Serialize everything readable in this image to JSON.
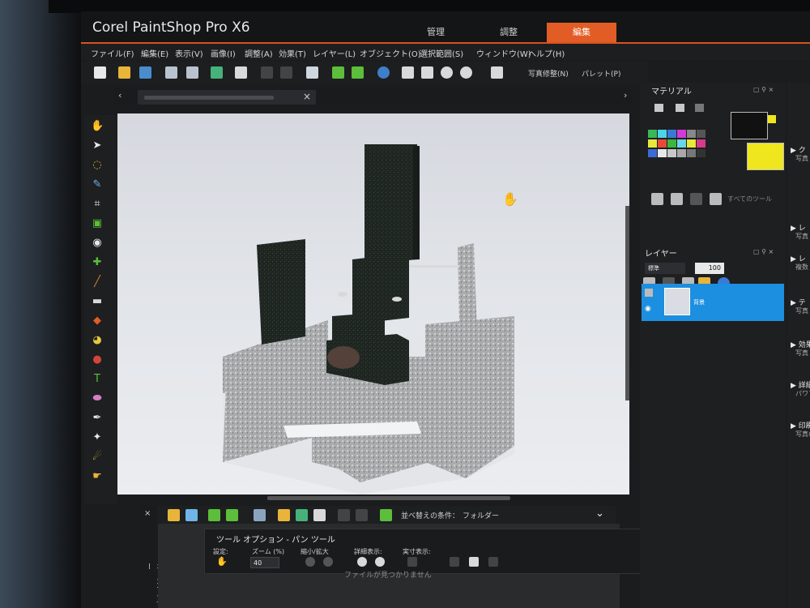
{
  "app": {
    "title": "Corel PaintShop Pro X6",
    "workspace_tabs": [
      {
        "label": "管理",
        "active": false
      },
      {
        "label": "調整",
        "active": false
      },
      {
        "label": "編集",
        "active": true
      }
    ],
    "accent_color": "#e25d25"
  },
  "menu": [
    "ファイル(F)",
    "編集(E)",
    "表示(V)",
    "画像(I)",
    "調整(A)",
    "効果(T)",
    "レイヤー(L)",
    "オブジェクト(O)",
    "選択範囲(S)",
    "ウィンドウ(W)",
    "ヘルプ(H)"
  ],
  "toolbar": {
    "photo_fix_label": "写真修整(N)",
    "palette_label": "パレット(P)"
  },
  "tools": [
    "pan-tool-icon",
    "pick-tool-icon",
    "selection-tool-icon",
    "dropper-icon",
    "crop-icon",
    "straighten-icon",
    "red-eye-icon",
    "makeover-icon",
    "clone-brush-icon",
    "scratch-remover-icon",
    "eraser-icon",
    "paint-bucket-icon",
    "brush-icon",
    "text-tool-icon",
    "shape-tool-icon",
    "pen-tool-icon",
    "warp-brush-icon",
    "lighten-brush-icon",
    "smudge-icon"
  ],
  "organizer": {
    "sort_label": "並べ替えの条件：",
    "sort_value": "フォルダー",
    "side_label": "オーガナイザー",
    "empty_message": "ファイルが見つかりません"
  },
  "tool_options": {
    "title": "ツール オプション - パン ツール",
    "preset_label": "設定:",
    "zoom_label": "ズーム (%)",
    "zoom_value": "40",
    "zoom_in_out_label": "縮小/拡大",
    "detail_view_label": "詳細表示:",
    "actual_size_label": "実寸表示:"
  },
  "materials_panel": {
    "title": "マテリアル",
    "all_tools_label": "すべてのツール"
  },
  "layers_panel": {
    "title": "レイヤー",
    "blend_mode": "標準",
    "opacity": "100",
    "layers": [
      {
        "name": "背景"
      }
    ]
  },
  "learning_center": {
    "items": [
      {
        "head": "▶ ク",
        "sub": "写真"
      },
      {
        "head": "▶ レ",
        "sub": "写真"
      },
      {
        "head": "▶ レ",
        "sub": "複数"
      },
      {
        "head": "▶ テ",
        "sub": "写真"
      },
      {
        "head": "▶ 効果",
        "sub": "写真"
      },
      {
        "head": "▶ 詳細",
        "sub": "パワフ"
      },
      {
        "head": "▶ 印刷",
        "sub": "写真の"
      }
    ]
  }
}
